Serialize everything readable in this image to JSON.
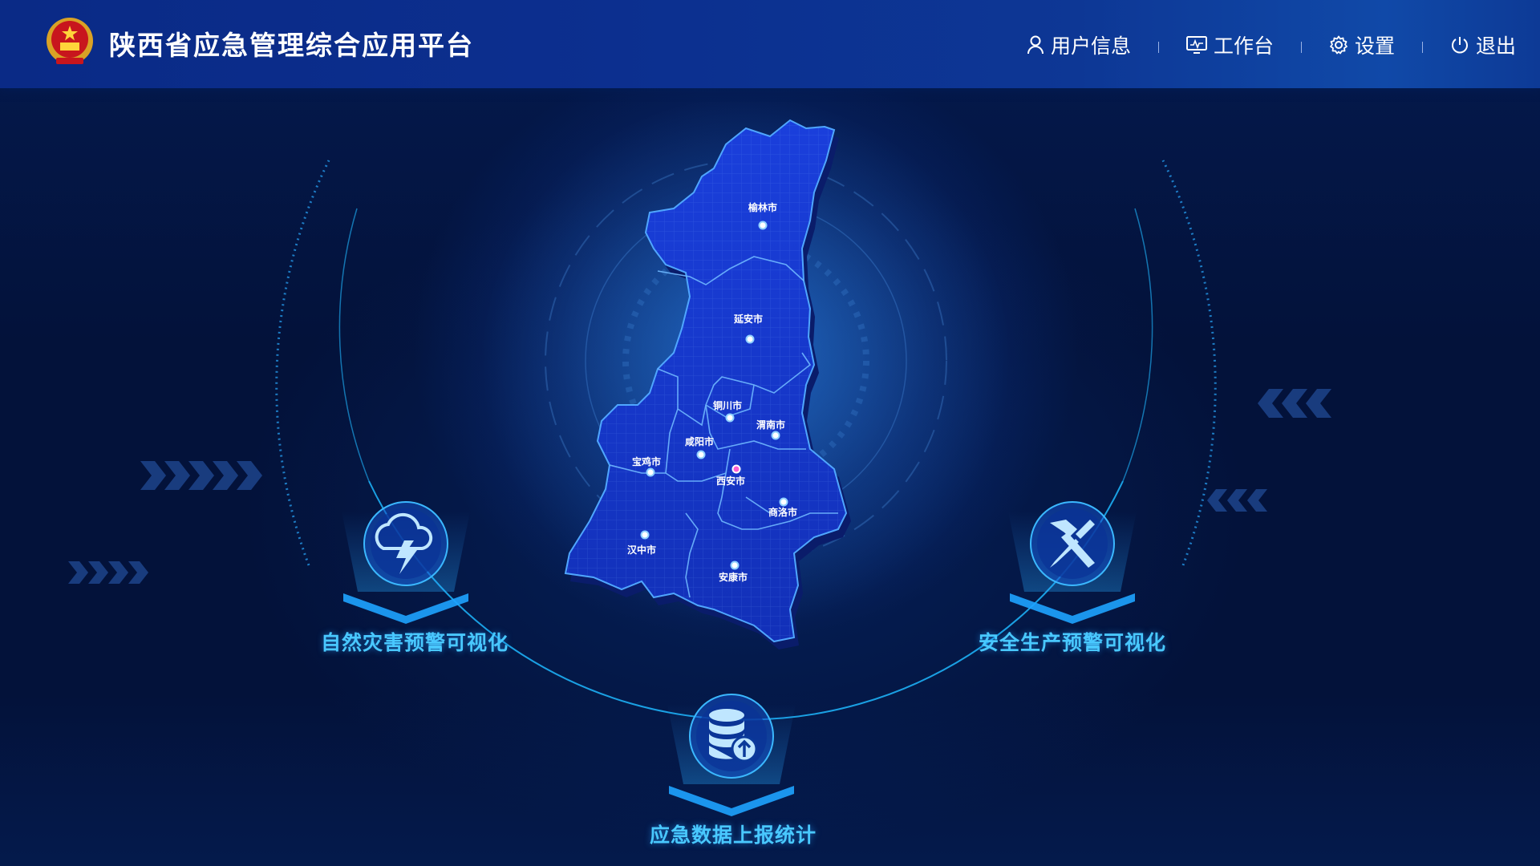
{
  "header": {
    "title": "陕西省应急管理综合应用平台",
    "nav": [
      {
        "label": "用户信息",
        "icon": "user-icon"
      },
      {
        "label": "工作台",
        "icon": "monitor-icon"
      },
      {
        "label": "设置",
        "icon": "gear-icon"
      },
      {
        "label": "退出",
        "icon": "power-icon"
      }
    ]
  },
  "map": {
    "cities": [
      {
        "name": "榆林市"
      },
      {
        "name": "延安市"
      },
      {
        "name": "铜川市"
      },
      {
        "name": "渭南市"
      },
      {
        "name": "咸阳市"
      },
      {
        "name": "宝鸡市"
      },
      {
        "name": "西安市"
      },
      {
        "name": "商洛市"
      },
      {
        "name": "汉中市"
      },
      {
        "name": "安康市"
      }
    ],
    "highlight_color": "#ff5fd2",
    "region_color": "#1438d0"
  },
  "features": [
    {
      "label": "自然灾害预警可视化",
      "icon": "storm-cloud-icon"
    },
    {
      "label": "安全生产预警可视化",
      "icon": "hammer-screwdriver-icon"
    },
    {
      "label": "应急数据上报统计",
      "icon": "database-upload-icon"
    }
  ],
  "colors": {
    "accent": "#49c8ff",
    "header_bg": "#0c2f8f",
    "page_bg": "#03123a"
  }
}
